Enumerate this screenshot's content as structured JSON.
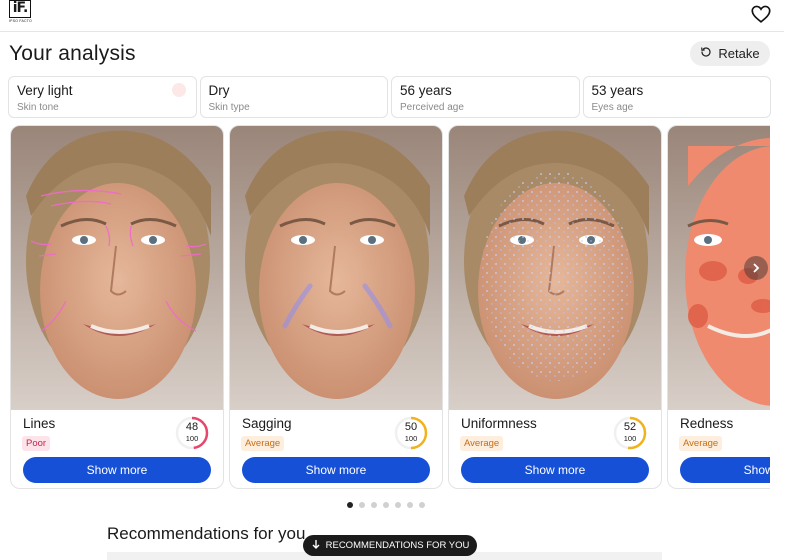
{
  "logo": {
    "mark": "iF.",
    "subtitle": "IPSO FACTO"
  },
  "header": {
    "title": "Your analysis",
    "retake_label": "Retake"
  },
  "summary": [
    {
      "value": "Very light",
      "label": "Skin tone",
      "swatch_color": "#fde8e8"
    },
    {
      "value": "Dry",
      "label": "Skin type"
    },
    {
      "value": "56 years",
      "label": "Perceived age"
    },
    {
      "value": "53 years",
      "label": "Eyes age"
    }
  ],
  "cards": [
    {
      "name": "Lines",
      "rating": "Poor",
      "score": "48",
      "max": "100",
      "ring_color": "#e8476c",
      "button": "Show more"
    },
    {
      "name": "Sagging",
      "rating": "Average",
      "score": "50",
      "max": "100",
      "ring_color": "#f2b21c",
      "button": "Show more"
    },
    {
      "name": "Uniformness",
      "rating": "Average",
      "score": "52",
      "max": "100",
      "ring_color": "#f2b21c",
      "button": "Show more"
    },
    {
      "name": "Redness",
      "rating": "Average",
      "score": "",
      "max": "",
      "ring_color": "#f2b21c",
      "button": "Show more"
    }
  ],
  "carousel": {
    "page_count": 7,
    "active_index": 0
  },
  "recommendations": {
    "heading": "Recommendations for you",
    "jump_label": "RECOMMENDATIONS FOR YOU"
  }
}
